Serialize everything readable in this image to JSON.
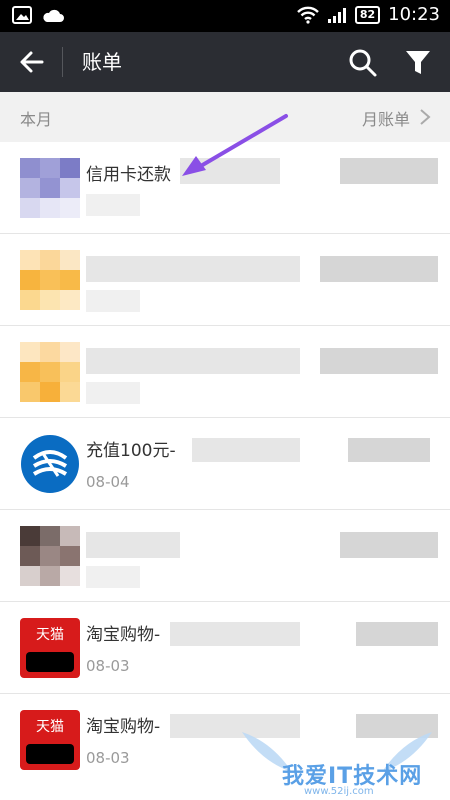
{
  "status_bar": {
    "battery": "82",
    "time": "10:23"
  },
  "header": {
    "title": "账单"
  },
  "month_bar": {
    "label": "本月",
    "monthly_bill": "月账单"
  },
  "transactions": [
    {
      "title": "信用卡还款",
      "date": ""
    },
    {
      "title": "",
      "date": ""
    },
    {
      "title": "",
      "date": ""
    },
    {
      "title": "充值100元-",
      "date": "08-04",
      "icon": "china-mobile-icon"
    },
    {
      "title": "",
      "date": ""
    },
    {
      "title": "淘宝购物-",
      "date": "08-03",
      "icon": "tmall-icon",
      "icon_text": "天猫"
    },
    {
      "title": "淘宝购物-",
      "date": "08-03",
      "icon": "tmall-icon",
      "icon_text": "天猫"
    }
  ],
  "watermark": {
    "text": "我爱IT技术网",
    "url": "www.52ij.com"
  },
  "colors": {
    "header_bg": "#2b2d33",
    "status_bg": "#000000",
    "arrow": "#8a4fe6",
    "tmall": "#d71b1b"
  }
}
